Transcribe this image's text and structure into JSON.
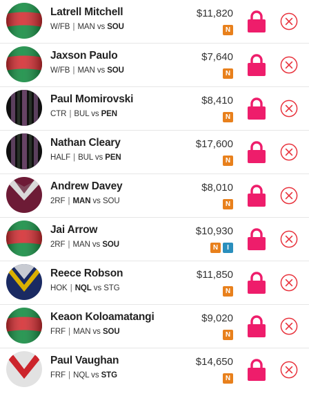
{
  "colors": {
    "lock": "#ee1d6b",
    "remove": "#e8323c",
    "badge_n": "#e8801c",
    "badge_i": "#2a8fbd"
  },
  "players": [
    {
      "name": "Latrell Mitchell",
      "position": "W/FB",
      "home": "MAN",
      "vs": "vs",
      "away": "SOU",
      "bold": "away",
      "price": "$11,820",
      "badges": [
        "N"
      ],
      "jersey": "rabbitohs"
    },
    {
      "name": "Jaxson Paulo",
      "position": "W/FB",
      "home": "MAN",
      "vs": "vs",
      "away": "SOU",
      "bold": "away",
      "price": "$7,640",
      "badges": [
        "N"
      ],
      "jersey": "rabbitohs"
    },
    {
      "name": "Paul Momirovski",
      "position": "CTR",
      "home": "BUL",
      "vs": "vs",
      "away": "PEN",
      "bold": "away",
      "price": "$8,410",
      "badges": [
        "N"
      ],
      "jersey": "panthers"
    },
    {
      "name": "Nathan Cleary",
      "position": "HALF",
      "home": "BUL",
      "vs": "vs",
      "away": "PEN",
      "bold": "away",
      "price": "$17,600",
      "badges": [
        "N"
      ],
      "jersey": "panthers"
    },
    {
      "name": "Andrew Davey",
      "position": "2RF",
      "home": "MAN",
      "vs": "vs",
      "away": "SOU",
      "bold": "home",
      "price": "$8,010",
      "badges": [
        "N"
      ],
      "jersey": "manly"
    },
    {
      "name": "Jai Arrow",
      "position": "2RF",
      "home": "MAN",
      "vs": "vs",
      "away": "SOU",
      "bold": "away",
      "price": "$10,930",
      "badges": [
        "N",
        "I"
      ],
      "jersey": "rabbitohs"
    },
    {
      "name": "Reece Robson",
      "position": "HOK",
      "home": "NQL",
      "vs": "vs",
      "away": "STG",
      "bold": "home",
      "price": "$11,850",
      "badges": [
        "N"
      ],
      "jersey": "cowboys"
    },
    {
      "name": "Keaon Koloamatangi",
      "position": "FRF",
      "home": "MAN",
      "vs": "vs",
      "away": "SOU",
      "bold": "away",
      "price": "$9,020",
      "badges": [
        "N"
      ],
      "jersey": "rabbitohs"
    },
    {
      "name": "Paul Vaughan",
      "position": "FRF",
      "home": "NQL",
      "vs": "vs",
      "away": "STG",
      "bold": "away",
      "price": "$14,650",
      "badges": [
        "N"
      ],
      "jersey": "dragons"
    }
  ]
}
